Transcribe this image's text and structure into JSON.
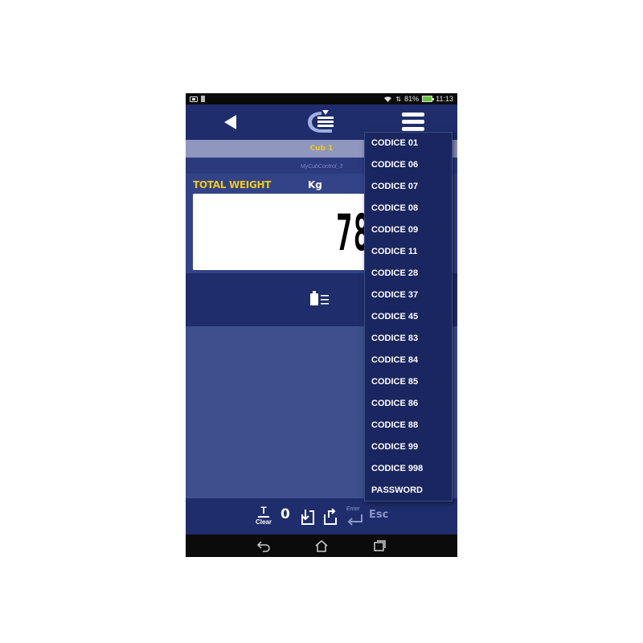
{
  "status_bar": {
    "battery": "81%",
    "time": "11:13"
  },
  "header": {
    "logo_icon": "cub-logo-icon",
    "back_icon": "back-arrow-icon",
    "menu_icon": "hamburger-menu-icon"
  },
  "cub": {
    "name": "Cub 1",
    "control": "MyCubControl_3"
  },
  "weight": {
    "label": "TOTAL WEIGHT",
    "unit": "Kg",
    "value": "78"
  },
  "toolbar": {
    "clear_top": "T",
    "clear_label": "Clear",
    "zero": "0",
    "enter_label": "Enter",
    "esc": "Esc"
  },
  "menu": {
    "items": [
      "CODICE 01",
      "CODICE 06",
      "CODICE 07",
      "CODICE 08",
      "CODICE 09",
      "CODICE 11",
      "CODICE 28",
      "CODICE 37",
      "CODICE 45",
      "CODICE 83",
      "CODICE 84",
      "CODICE 85",
      "CODICE 86",
      "CODICE 88",
      "CODICE 99",
      "CODICE 998",
      "PASSWORD"
    ]
  },
  "colors": {
    "header": "#1f2d6c",
    "accent_yellow": "#f2c81a",
    "panel": "#3d4f8d",
    "status": "#0b0b0b"
  }
}
